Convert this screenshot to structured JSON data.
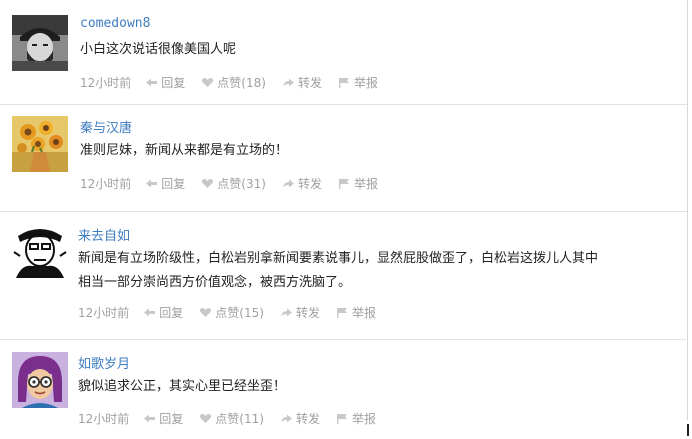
{
  "comments": [
    {
      "avatar": "bearded-man-with-cap-icon",
      "username": "comedown8",
      "text_lines": [
        "小白这次说话很像美国人呢"
      ],
      "time": "12小时前",
      "reply": "回复",
      "like": "点赞(18)",
      "forward": "转发",
      "report": "举报"
    },
    {
      "avatar": "sunflowers-painting-icon",
      "username": "秦与汉唐",
      "text_lines": [
        "准则尼妹，新闻从来都是有立场的！"
      ],
      "time": "12小时前",
      "reply": "回复",
      "like": "点赞(31)",
      "forward": "转发",
      "report": "举报"
    },
    {
      "avatar": "sketch-portrait-icon",
      "username": "来去自如",
      "text_lines": [
        "新闻是有立场阶级性，白松岩别拿新闻要素说事儿，显然屁股做歪了，白松岩这拨儿人其中",
        "相当一部分崇尚西方价值观念，被西方洗脑了。"
      ],
      "time": "12小时前",
      "reply": "回复",
      "like": "点赞(15)",
      "forward": "转发",
      "report": "举报"
    },
    {
      "avatar": "cartoon-woman-glasses-icon",
      "username": "如歌岁月",
      "text_lines": [
        "貌似追求公正，其实心里已经坐歪！"
      ],
      "time": "12小时前",
      "reply": "回复",
      "like": "点赞(11)",
      "forward": "转发",
      "report": "举报"
    }
  ],
  "colors": {
    "username": "#3e7cc1",
    "meta": "#a0a0a0",
    "text": "#222222",
    "divider": "#e3e3e3"
  }
}
